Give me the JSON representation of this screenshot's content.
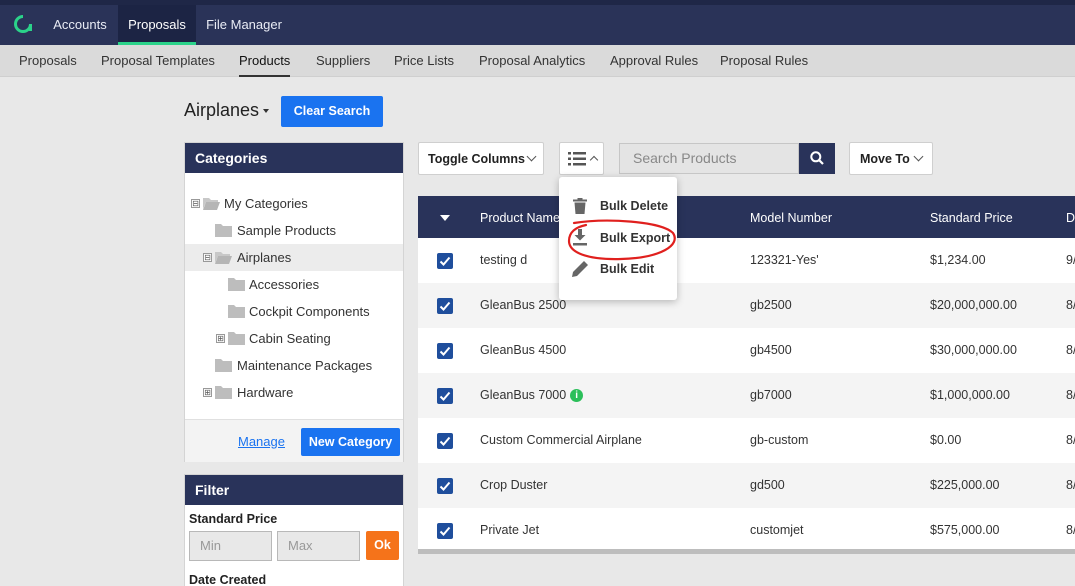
{
  "topnav": {
    "logo_icon": "app-logo-icon",
    "items": [
      "Accounts",
      "Proposals",
      "File Manager"
    ],
    "active": "Proposals"
  },
  "subnav": {
    "items": [
      "Proposals",
      "Proposal Templates",
      "Products",
      "Suppliers",
      "Price Lists",
      "Proposal Analytics",
      "Approval Rules",
      "Proposal Rules"
    ],
    "active": "Products"
  },
  "heading": {
    "category": "Airplanes",
    "clear_search": "Clear Search"
  },
  "categories": {
    "title": "Categories",
    "tree": [
      {
        "label": "My Categories",
        "expander": "⊟"
      },
      {
        "label": "Sample Products"
      },
      {
        "label": "Airplanes",
        "expander": "⊟"
      },
      {
        "label": "Accessories"
      },
      {
        "label": "Cockpit Components"
      },
      {
        "label": "Cabin Seating",
        "expander": "⊞"
      },
      {
        "label": "Maintenance Packages"
      },
      {
        "label": "Hardware",
        "expander": "⊞"
      }
    ],
    "manage": "Manage",
    "new_category": "New Category"
  },
  "filter": {
    "title": "Filter",
    "standard_price": "Standard Price",
    "min_placeholder": "Min",
    "max_placeholder": "Max",
    "ok": "Ok",
    "date_created": "Date Created"
  },
  "toolbar": {
    "toggle_columns": "Toggle Columns",
    "list_menu_icon": "list-icon",
    "search_placeholder": "Search Products",
    "move_to": "Move To"
  },
  "menu": {
    "items": [
      {
        "label": "Bulk Delete",
        "icon": "trash-icon"
      },
      {
        "label": "Bulk Export",
        "icon": "download-icon"
      },
      {
        "label": "Bulk Edit",
        "icon": "pencil-icon"
      }
    ]
  },
  "table": {
    "columns": [
      "Product Name",
      "Model Number",
      "Standard Price",
      "D"
    ],
    "rows": [
      {
        "name": "testing d",
        "model": "123321-Yes'",
        "price": "$1,234.00",
        "extra": "9/"
      },
      {
        "name": "GleanBus 2500",
        "model": "gb2500",
        "price": "$20,000,000.00",
        "extra": "8/"
      },
      {
        "name": "GleanBus 4500",
        "model": "gb4500",
        "price": "$30,000,000.00",
        "extra": "8/"
      },
      {
        "name": "GleanBus 7000",
        "model": "gb7000",
        "price": "$1,000,000.00",
        "extra": "8/",
        "info": "i"
      },
      {
        "name": "Custom Commercial Airplane",
        "model": "gb-custom",
        "price": "$0.00",
        "extra": "8/"
      },
      {
        "name": "Crop Duster",
        "model": "gd500",
        "price": "$225,000.00",
        "extra": "8/"
      },
      {
        "name": "Private Jet",
        "model": "customjet",
        "price": "$575,000.00",
        "extra": "8/"
      }
    ]
  },
  "colors": {
    "navy": "#29335a",
    "blue": "#1a73f0",
    "orange": "#f5731a",
    "green": "#2bd38a",
    "annotation": "#e0201e"
  }
}
